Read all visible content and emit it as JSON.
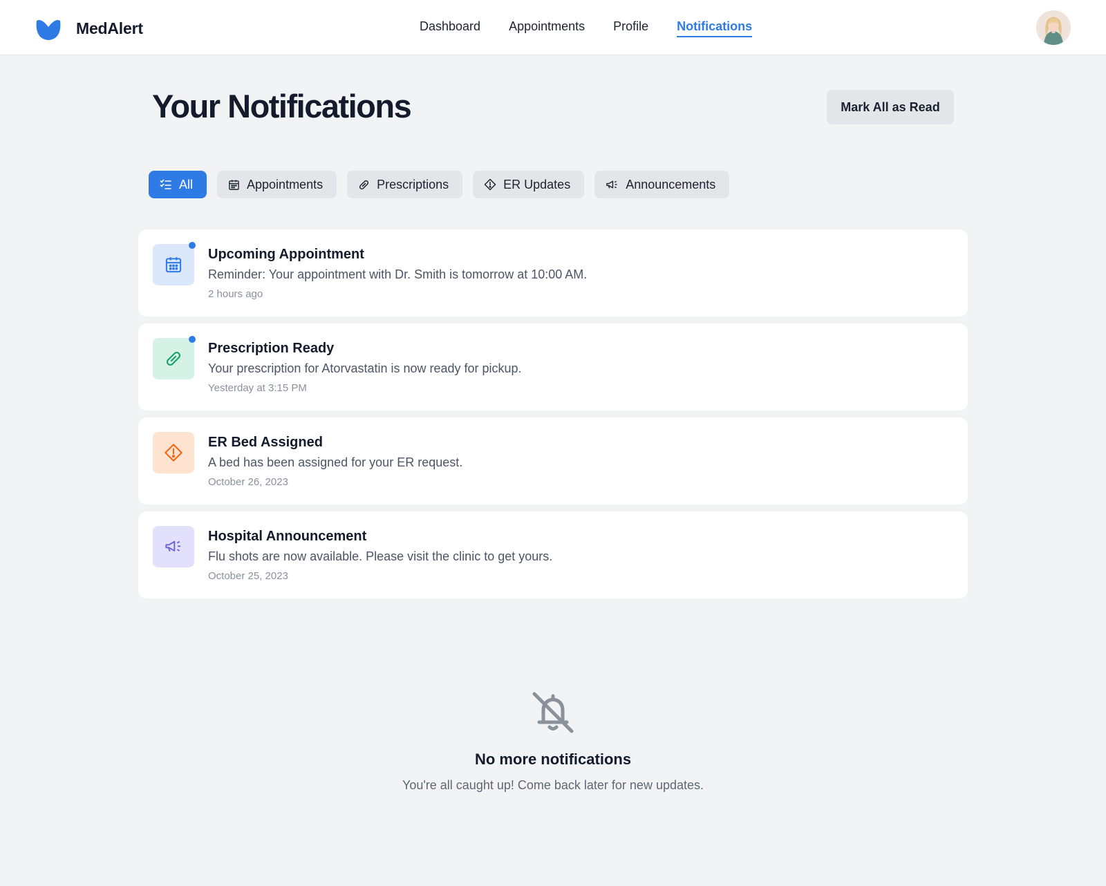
{
  "brand": {
    "name": "MedAlert",
    "accent": "#2f7be6"
  },
  "nav": {
    "items": [
      {
        "label": "Dashboard",
        "active": false
      },
      {
        "label": "Appointments",
        "active": false
      },
      {
        "label": "Profile",
        "active": false
      },
      {
        "label": "Notifications",
        "active": true
      }
    ]
  },
  "header": {
    "title": "Your Notifications",
    "mark_all_label": "Mark All as Read"
  },
  "filters": [
    {
      "label": "All",
      "icon": "checklist-icon",
      "active": true
    },
    {
      "label": "Appointments",
      "icon": "calendar-icon",
      "active": false
    },
    {
      "label": "Prescriptions",
      "icon": "pill-icon",
      "active": false
    },
    {
      "label": "ER Updates",
      "icon": "alert-diamond-icon",
      "active": false
    },
    {
      "label": "Announcements",
      "icon": "megaphone-icon",
      "active": false
    }
  ],
  "notifications": [
    {
      "title": "Upcoming Appointment",
      "body": "Reminder: Your appointment with Dr. Smith is tomorrow at 10:00 AM.",
      "time": "2 hours ago",
      "icon": "calendar-icon",
      "icon_color": "#2f7be6",
      "icon_bg": "#dbe8fc",
      "unread": true
    },
    {
      "title": "Prescription Ready",
      "body": "Your prescription for Atorvastatin is now ready for pickup.",
      "time": "Yesterday at 3:15 PM",
      "icon": "pill-icon",
      "icon_color": "#16a36b",
      "icon_bg": "#d6f2e6",
      "unread": true
    },
    {
      "title": "ER Bed Assigned",
      "body": "A bed has been assigned for your ER request.",
      "time": "October 26, 2023",
      "icon": "alert-diamond-icon",
      "icon_color": "#ef6a18",
      "icon_bg": "#fde3d0",
      "unread": false
    },
    {
      "title": "Hospital Announcement",
      "body": "Flu shots are now available. Please visit the clinic to get yours.",
      "time": "October 25, 2023",
      "icon": "megaphone-icon",
      "icon_color": "#6a5fd8",
      "icon_bg": "#e3e0fb",
      "unread": false
    }
  ],
  "empty_state": {
    "icon": "bell-off-icon",
    "title": "No more notifications",
    "text": "You're all caught up! Come back later for new updates."
  }
}
